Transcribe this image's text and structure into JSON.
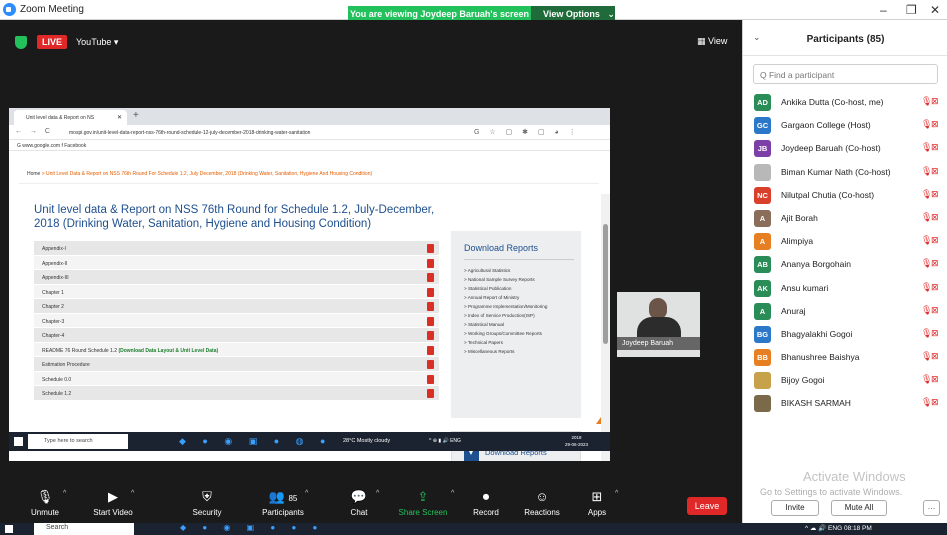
{
  "window": {
    "title": "Zoom Meeting",
    "minimize": "–",
    "maximize": "❐",
    "close": "✕"
  },
  "share_banner": {
    "text": "You are viewing Joydeep Baruah's screen",
    "options_label": "View Options",
    "options_caret": "⌄"
  },
  "stream": {
    "live_label": "LIVE",
    "platform": "YouTube ▾",
    "view_label": "▦ View"
  },
  "browser": {
    "tab_title": "Unit level data & Report on NS",
    "tab_close": "✕",
    "new_tab": "+",
    "nav": "← → C",
    "url": "mospi.gov.in/unit-level-data-report-nss-76th-round-schedule-12-july-december-2018-drinking-water-sanitation",
    "addr_icons": "G ☆ ▢ ✱ ▢ ◕ ⋮",
    "bookmarks": "G www.google.com   f Facebook"
  },
  "page": {
    "breadcrumb_home": "Home",
    "breadcrumb_rest": " > Unit Level Data & Report on NSS 76th Round For Schedule 1.2, July December, 2018 (Drinking Water, Sanitation, Hygiene And Housing Condition)",
    "title": "Unit level data & Report on NSS 76th Round for Schedule 1.2, July-December, 2018 (Drinking Water, Sanitation, Hygiene and Housing Condition)",
    "docs": [
      "Appendix-I",
      "Appendix-II",
      "Appendix-III",
      "Chapter 1",
      "Chapter 2",
      "Chapter-3",
      "Chapter-4"
    ],
    "readme_prefix": "README 76 Round Schedule 1.2 ",
    "readme_link": "(Download Data Layout & Unit Level Data)",
    "docs_after": [
      "Estimation Procedure",
      "Schedule 0.0",
      "Schedule 1.2"
    ],
    "panel_title": "Download Reports",
    "panel_links": [
      "Agricultural Statistics",
      "National Sample Survey Reports",
      "Statistical Publication",
      "Annual Report of Ministry",
      "Programme Implementation/Monitoring",
      "Index of Service Production(ISP)",
      "Statistical Manual",
      "Working Groups/Committee Reports",
      "Technical Papers",
      "Miscellaneous Reports"
    ],
    "download_box_label": "Download Reports"
  },
  "inner_taskbar": {
    "search_placeholder": "Type here to search",
    "weather": "28°C  Mostly cloudy",
    "tray": "^ ⊕ ▮ 🔊 ENG",
    "time": "2018",
    "date": "29-06-2023",
    "apps": "◆ ● ◉ ▣ ● ◍ ●"
  },
  "video_tile": {
    "name": "Joydeep Baruah"
  },
  "controls": [
    {
      "label": "Unmute",
      "icon": "🎙"
    },
    {
      "label": "Start Video",
      "icon": "▶"
    },
    {
      "label": "Security",
      "icon": "⛨"
    },
    {
      "label": "Participants",
      "icon": "👥",
      "badge": "85"
    },
    {
      "label": "Chat",
      "icon": "💬"
    },
    {
      "label": "Share Screen",
      "icon": "⇪"
    },
    {
      "label": "Record",
      "icon": "⏺"
    },
    {
      "label": "Reactions",
      "icon": "☺"
    },
    {
      "label": "Apps",
      "icon": "⊞"
    }
  ],
  "leave_label": "Leave",
  "participants_panel": {
    "chevron": "⌄",
    "title": "Participants (85)",
    "search_placeholder": "Q Find a participant",
    "mic_icon": "🎙",
    "cam_icon": "⊠",
    "items": [
      {
        "initials": "AD",
        "name": "Ankika Dutta (Co-host, me)",
        "color": "#2a8c56"
      },
      {
        "initials": "GC",
        "name": "Gargaon College (Host)",
        "color": "#2b78c8"
      },
      {
        "initials": "JB",
        "name": "Joydeep Baruah (Co-host)",
        "color": "#7c3fa8"
      },
      {
        "initials": "",
        "name": "Biman Kumar Nath (Co-host)",
        "color": "#b8b8b8"
      },
      {
        "initials": "NC",
        "name": "Nilutpal Chutia (Co-host)",
        "color": "#d9402c"
      },
      {
        "initials": "A",
        "name": "Ajit Borah",
        "color": "#8a6d5a"
      },
      {
        "initials": "A",
        "name": "Alimpiya",
        "color": "#e67e22"
      },
      {
        "initials": "AB",
        "name": "Ananya Borgohain",
        "color": "#2a8c56"
      },
      {
        "initials": "AK",
        "name": "Ansu kumari",
        "color": "#2a8c56"
      },
      {
        "initials": "A",
        "name": "Anuraj",
        "color": "#2a8c56"
      },
      {
        "initials": "BG",
        "name": "Bhagyalakhi Gogoi",
        "color": "#2b78c8"
      },
      {
        "initials": "BB",
        "name": "Bhanushree Baishya",
        "color": "#e67e22"
      },
      {
        "initials": "",
        "name": "Bijoy Gogoi",
        "color": "#c8a24a"
      },
      {
        "initials": "",
        "name": "BIKASH SARMAH",
        "color": "#7a6a4a"
      }
    ],
    "watermark": "Activate Windows",
    "watermark_sub": "Go to Settings to activate Windows.",
    "invite_label": "Invite",
    "mute_all_label": "Mute All",
    "more_label": "…"
  },
  "win_taskbar": {
    "search_placeholder": "Search",
    "tray": "^ ☁ 🔊 ENG  08:18 PM",
    "apps": "◆ ● ◉ ▣ ● ● ●"
  }
}
